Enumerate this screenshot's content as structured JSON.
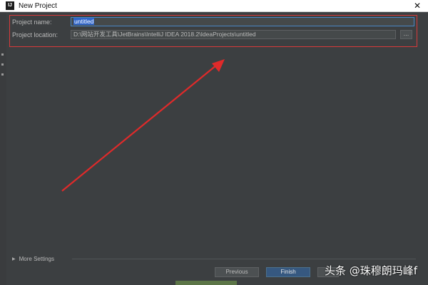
{
  "window": {
    "title": "New Project",
    "close_glyph": "✕",
    "app_icon": "intellij-icon"
  },
  "form": {
    "name_label": "Project name:",
    "name_value": "untitled",
    "location_label": "Project location:",
    "location_value": "D:\\网站开发工具\\JetBrains\\IntelliJ IDEA 2018.2\\IdeaProjects\\untitled",
    "browse_label": "..."
  },
  "more_settings": {
    "label": "More Settings",
    "chevron": "▶"
  },
  "buttons": {
    "previous": "Previous",
    "finish": "Finish"
  },
  "annotation": {
    "color": "#e02a2a"
  },
  "watermark": {
    "text": "头条 @珠穆朗玛峰f"
  }
}
